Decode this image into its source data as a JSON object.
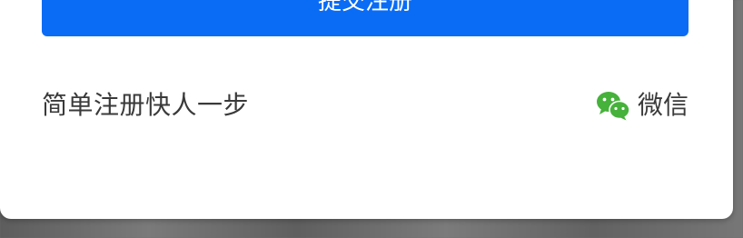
{
  "form": {
    "submit_label": "提交注册",
    "tagline": "简单注册快人一步",
    "wechat_label": "微信"
  },
  "colors": {
    "primary": "#0a6cf5",
    "wechat_green": "#46b13b",
    "text": "#3a3a3a"
  },
  "icons": {
    "wechat": "wechat-icon"
  }
}
